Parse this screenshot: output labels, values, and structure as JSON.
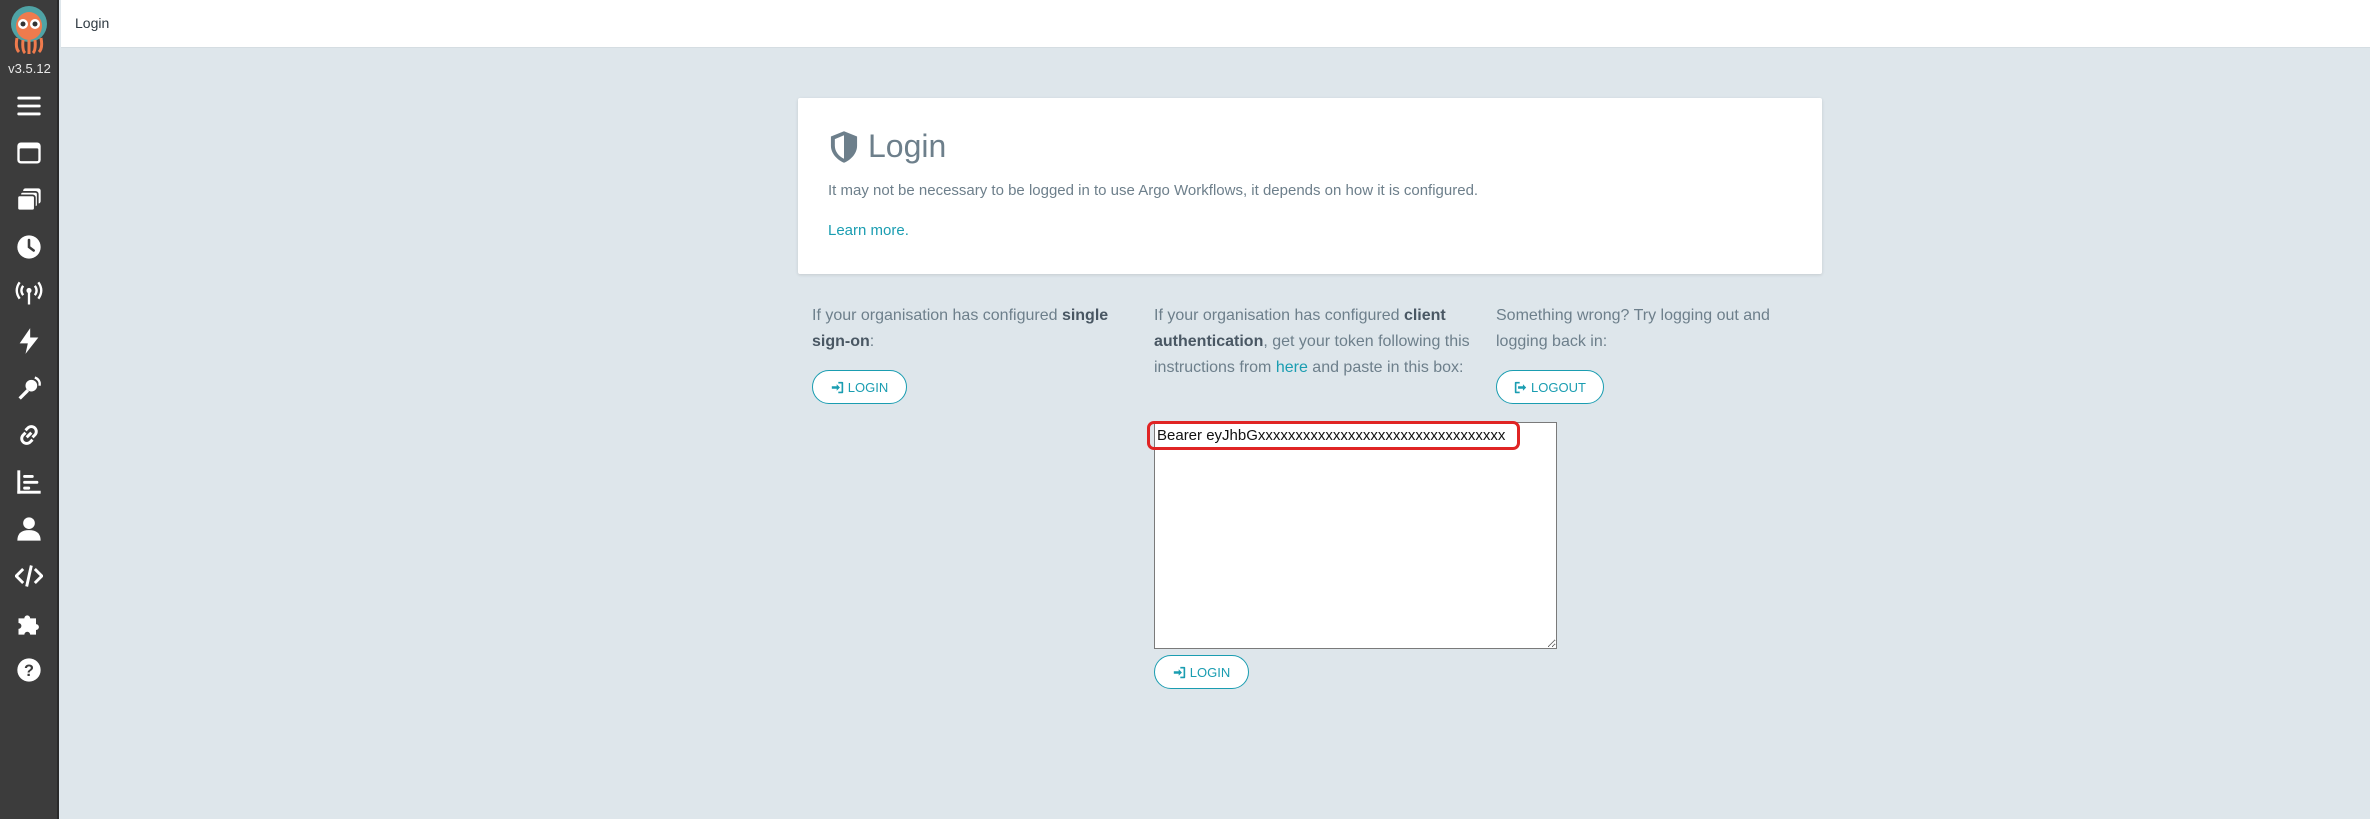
{
  "app": {
    "version": "v3.5.12",
    "page_title": "Login"
  },
  "sidebar": {
    "items": [
      {
        "icon": "hamburger-menu-icon"
      },
      {
        "icon": "workflows-icon"
      },
      {
        "icon": "workflow-templates-icon"
      },
      {
        "icon": "cron-workflows-icon"
      },
      {
        "icon": "event-sources-icon"
      },
      {
        "icon": "sensors-icon"
      },
      {
        "icon": "event-flow-icon"
      },
      {
        "icon": "link-icon"
      },
      {
        "icon": "reports-icon"
      },
      {
        "icon": "user-icon"
      },
      {
        "icon": "api-docs-icon"
      },
      {
        "icon": "plugins-icon"
      },
      {
        "icon": "help-icon"
      }
    ]
  },
  "card": {
    "title": "Login",
    "description": "It may not be necessary to be logged in to use Argo Workflows, it depends on how it is configured.",
    "learn_more": "Learn more."
  },
  "sso": {
    "text_before": "If your organisation has configured ",
    "text_bold": "single sign-on",
    "text_after": ":",
    "button_label": "LOGIN"
  },
  "client_auth": {
    "text_before": "If your organisation has configured ",
    "text_bold": "client authentication",
    "text_mid": ", get your token following this instructions from ",
    "link": "here",
    "text_after": " and paste in this box:",
    "token_value": "Bearer eyJhbGxxxxxxxxxxxxxxxxxxxxxxxxxxxxxxxxx",
    "button_label": "LOGIN"
  },
  "logout": {
    "text": "Something wrong? Try logging out and logging back in:",
    "button_label": "LOGOUT"
  },
  "colors": {
    "accent": "#1a9db1",
    "sidebar_bg": "#3c3c3c",
    "page_bg": "#dee6eb",
    "highlight": "#e02424"
  }
}
